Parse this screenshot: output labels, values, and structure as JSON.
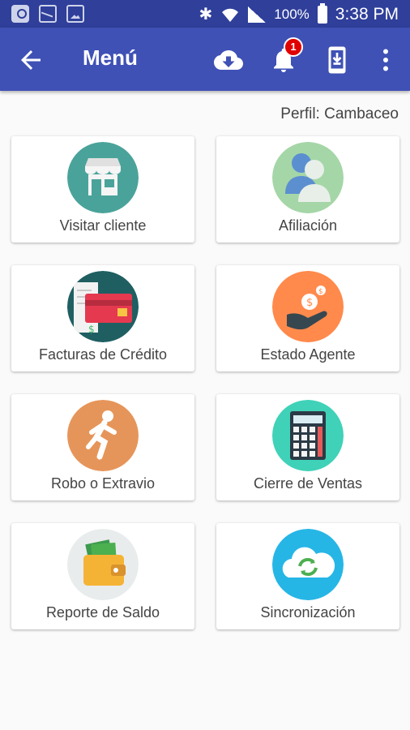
{
  "status_bar": {
    "battery": "100%",
    "time": "3:38 PM"
  },
  "app_bar": {
    "title": "Menú",
    "notification_count": "1"
  },
  "profile_label": "Perfil: Cambaceo",
  "menu": [
    {
      "label": "Visitar cliente",
      "icon": "store-icon",
      "color": "#4aa39a"
    },
    {
      "label": "Afiliación",
      "icon": "users-icon",
      "color": "#a5d6a7"
    },
    {
      "label": "Facturas de Crédito",
      "icon": "credit-card-icon",
      "color": "#1f5f62"
    },
    {
      "label": "Estado Agente",
      "icon": "money-hand-icon",
      "color": "#ff8a4c"
    },
    {
      "label": "Robo o Extravio",
      "icon": "running-man-icon",
      "color": "#e6955a"
    },
    {
      "label": "Cierre de Ventas",
      "icon": "calculator-icon",
      "color": "#3fd2b8"
    },
    {
      "label": "Reporte de Saldo",
      "icon": "wallet-icon",
      "color": "#e9ecec"
    },
    {
      "label": "Sincronización",
      "icon": "cloud-sync-icon",
      "color": "#26b6e6"
    }
  ]
}
